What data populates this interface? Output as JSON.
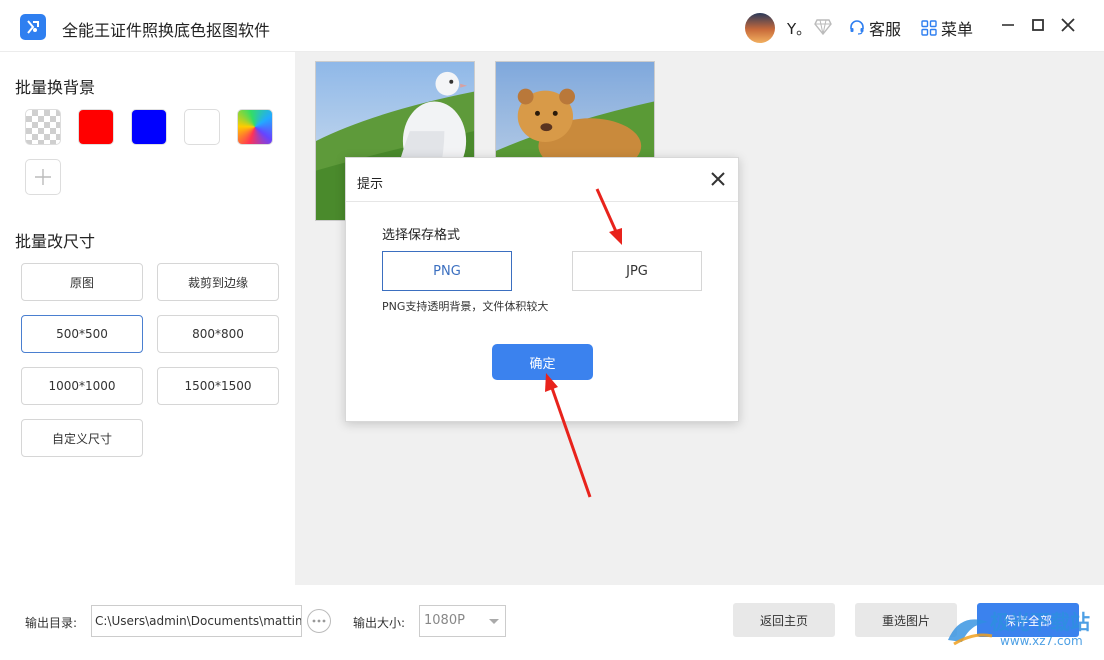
{
  "titlebar": {
    "app_title": "全能王证件照换底色抠图软件",
    "user_name": "Y。",
    "service_label": "客服",
    "menu_label": "菜单"
  },
  "left": {
    "bg_section_title": "批量换背景",
    "size_section_title": "批量改尺寸",
    "swatch_colors": [
      "transparent",
      "#ff0000",
      "#0000ff",
      "#ffffff",
      "gradient"
    ],
    "size_options": [
      "原图",
      "裁剪到边缘",
      "500*500",
      "800*800",
      "1000*1000",
      "1500*1500",
      "自定义尺寸"
    ],
    "selected_size": "500*500"
  },
  "bottom": {
    "output_dir_label": "输出目录:",
    "output_dir_value": "C:\\Users\\admin\\Documents\\matting",
    "output_size_label": "输出大小:",
    "output_size_value": "1080P",
    "home_button": "返回主页",
    "reselect_button": "重选图片",
    "save_all_button": "保存全部"
  },
  "modal": {
    "title": "提示",
    "label": "选择保存格式",
    "png_option": "PNG",
    "jpg_option": "JPG",
    "hint": "PNG支持透明背景，文件体积较大",
    "confirm_button": "确定"
  },
  "watermark": {
    "text": "极光下载站",
    "url": "www.xz7.com"
  },
  "colors": {
    "accent": "#3b82ee",
    "arrow": "#e8231c"
  }
}
